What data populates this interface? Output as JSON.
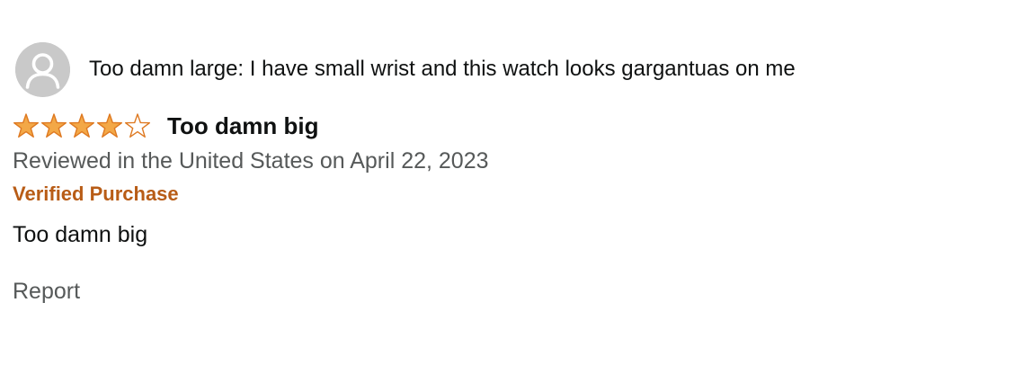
{
  "review": {
    "profile_name": "Too damn large: I have small wrist and this watch looks gargantuas on me",
    "avatar_icon": "default-user-avatar-icon",
    "rating": 4,
    "rating_max": 5,
    "star_icon": "star-icon",
    "star_color": "#f3a847",
    "title": "Too damn big",
    "date_line": "Reviewed in the United States on April 22, 2023",
    "verified_label": "Verified Purchase",
    "verified_color": "#b85c16",
    "body": "Too damn big",
    "report_label": "Report"
  }
}
